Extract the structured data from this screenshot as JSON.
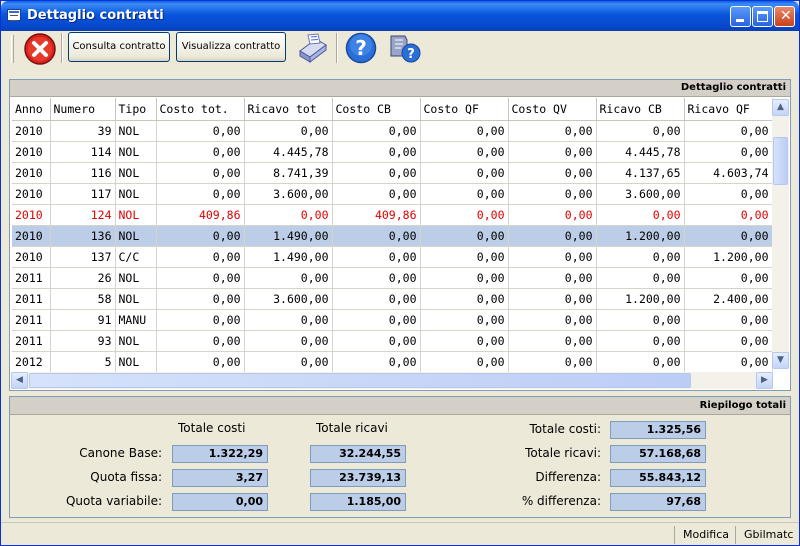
{
  "window": {
    "title": "Dettaglio contratti"
  },
  "toolbar": {
    "consulta_label": "Consulta contratto",
    "visualizza_label": "Visualizza contratto"
  },
  "grid": {
    "title": "Dettaglio contratti",
    "columns": [
      "Anno",
      "Numero",
      "Tipo",
      "Costo tot.",
      "Ricavo tot",
      "Costo CB",
      "Costo QF",
      "Costo QV",
      "Ricavo CB",
      "Ricavo QF"
    ],
    "rows": [
      [
        "2010",
        "39",
        "NOL",
        "0,00",
        "0,00",
        "0,00",
        "0,00",
        "0,00",
        "0,00",
        "0,00"
      ],
      [
        "2010",
        "114",
        "NOL",
        "0,00",
        "4.445,78",
        "0,00",
        "0,00",
        "0,00",
        "4.445,78",
        "0,00"
      ],
      [
        "2010",
        "116",
        "NOL",
        "0,00",
        "8.741,39",
        "0,00",
        "0,00",
        "0,00",
        "4.137,65",
        "4.603,74"
      ],
      [
        "2010",
        "117",
        "NOL",
        "0,00",
        "3.600,00",
        "0,00",
        "0,00",
        "0,00",
        "3.600,00",
        "0,00"
      ],
      [
        "2010",
        "124",
        "NOL",
        "409,86",
        "0,00",
        "409,86",
        "0,00",
        "0,00",
        "0,00",
        "0,00"
      ],
      [
        "2010",
        "136",
        "NOL",
        "0,00",
        "1.490,00",
        "0,00",
        "0,00",
        "0,00",
        "1.200,00",
        "0,00"
      ],
      [
        "2010",
        "137",
        "C/C",
        "0,00",
        "1.490,00",
        "0,00",
        "0,00",
        "0,00",
        "0,00",
        "1.200,00"
      ],
      [
        "2011",
        "26",
        "NOL",
        "0,00",
        "0,00",
        "0,00",
        "0,00",
        "0,00",
        "0,00",
        "0,00"
      ],
      [
        "2011",
        "58",
        "NOL",
        "0,00",
        "3.600,00",
        "0,00",
        "0,00",
        "0,00",
        "1.200,00",
        "2.400,00"
      ],
      [
        "2011",
        "91",
        "MANU",
        "0,00",
        "0,00",
        "0,00",
        "0,00",
        "0,00",
        "0,00",
        "0,00"
      ],
      [
        "2011",
        "93",
        "NOL",
        "0,00",
        "0,00",
        "0,00",
        "0,00",
        "0,00",
        "0,00",
        "0,00"
      ],
      [
        "2012",
        "5",
        "NOL",
        "0,00",
        "0,00",
        "0,00",
        "0,00",
        "0,00",
        "0,00",
        "0,00"
      ]
    ],
    "highlight_row": 4,
    "selected_row": 5
  },
  "summary": {
    "title": "Riepilogo totali",
    "col_costi": "Totale costi",
    "col_ricavi": "Totale ricavi",
    "rows": [
      {
        "label": "Canone Base:",
        "costi": "1.322,29",
        "ricavi": "32.244,55"
      },
      {
        "label": "Quota fissa:",
        "costi": "3,27",
        "ricavi": "23.739,13"
      },
      {
        "label": "Quota variabile:",
        "costi": "0,00",
        "ricavi": "1.185,00"
      }
    ],
    "totals": [
      {
        "label": "Totale costi:",
        "value": "1.325,56"
      },
      {
        "label": "Totale ricavi:",
        "value": "57.168,68"
      },
      {
        "label": "Differenza:",
        "value": "55.843,12"
      },
      {
        "label": "% differenza:",
        "value": "97,68"
      }
    ]
  },
  "status": {
    "mode": "Modifica",
    "user": "Gbilmatc"
  },
  "colors": {
    "highlight_text": "#e00000",
    "selected_row": "#bccde8",
    "value_box": "#bccde8"
  }
}
